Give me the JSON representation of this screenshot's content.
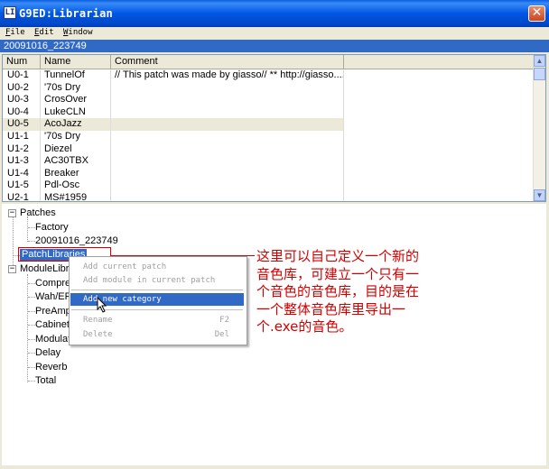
{
  "window": {
    "title": "G9ED:Librarian",
    "app_icon": "LI",
    "close_icon": "close-icon"
  },
  "menu": [
    "File",
    "Edit",
    "Window"
  ],
  "current_patch": "20091016_223749",
  "table": {
    "columns": [
      "Num",
      "Name",
      "Comment"
    ],
    "rows": [
      {
        "num": "U0-1",
        "name": "TunnelOf",
        "comment": "// This patch was made by giasso// ** http://giasso...."
      },
      {
        "num": "U0-2",
        "name": "'70s Dry",
        "comment": ""
      },
      {
        "num": "U0-3",
        "name": "CrosOver",
        "comment": ""
      },
      {
        "num": "U0-4",
        "name": "LukeCLN",
        "comment": ""
      },
      {
        "num": "U0-5",
        "name": "AcoJazz",
        "comment": ""
      },
      {
        "num": "U1-1",
        "name": "'70s Dry",
        "comment": ""
      },
      {
        "num": "U1-2",
        "name": "Diezel",
        "comment": ""
      },
      {
        "num": "U1-3",
        "name": "AC30TBX",
        "comment": ""
      },
      {
        "num": "U1-4",
        "name": "Breaker",
        "comment": ""
      },
      {
        "num": "U1-5",
        "name": "Pdl-Osc",
        "comment": ""
      },
      {
        "num": "U2-1",
        "name": "MS#1959",
        "comment": ""
      }
    ]
  },
  "tree": {
    "patches": "Patches",
    "factory": "Factory",
    "patch_date": "20091016_223749",
    "patch_libraries": "PatchLibraries",
    "module_library": "ModuleLibr",
    "modules": [
      "Compre",
      "Wah/EF",
      "PreAmp",
      "Cabinet",
      "Modulat",
      "Delay",
      "Reverb",
      "Total"
    ]
  },
  "context_menu": {
    "items": [
      {
        "label": "Add current patch",
        "shortcut": ""
      },
      {
        "label": "Add module in current patch",
        "shortcut": ""
      },
      {
        "label": "Add new category",
        "shortcut": ""
      },
      {
        "label": "Rename",
        "shortcut": "F2"
      },
      {
        "label": "Delete",
        "shortcut": "Del"
      }
    ]
  },
  "annotation": "这里可以自己定义一个新的音色库，可建立一个只有一个音色的音色库，目的是在一个整体音色库里导出一个.exe的音色。",
  "colors": {
    "title_bar": "#0054e3",
    "selection": "#316ac5",
    "annotation_red": "#d40000"
  }
}
